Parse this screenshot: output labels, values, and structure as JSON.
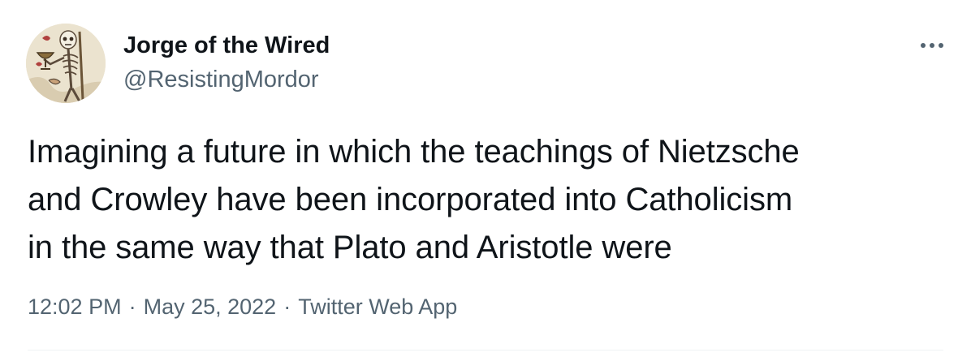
{
  "author": {
    "display_name": "Jorge of the Wired",
    "handle": "@ResistingMordor",
    "avatar_icon": "medieval-skeleton-avatar"
  },
  "more_icon": "more-options-icon",
  "tweet": {
    "lines": [
      "Imagining a future in which the teachings of Nietzsche",
      "and Crowley have been incorporated into Catholicism",
      "in the same way that Plato and Aristotle were"
    ]
  },
  "meta": {
    "time": "12:02 PM",
    "separator": "·",
    "date": "May 25, 2022",
    "source": "Twitter Web App"
  },
  "colors": {
    "primary_text": "#0f1419",
    "secondary_text": "#536471",
    "divider": "#eff3f4"
  }
}
